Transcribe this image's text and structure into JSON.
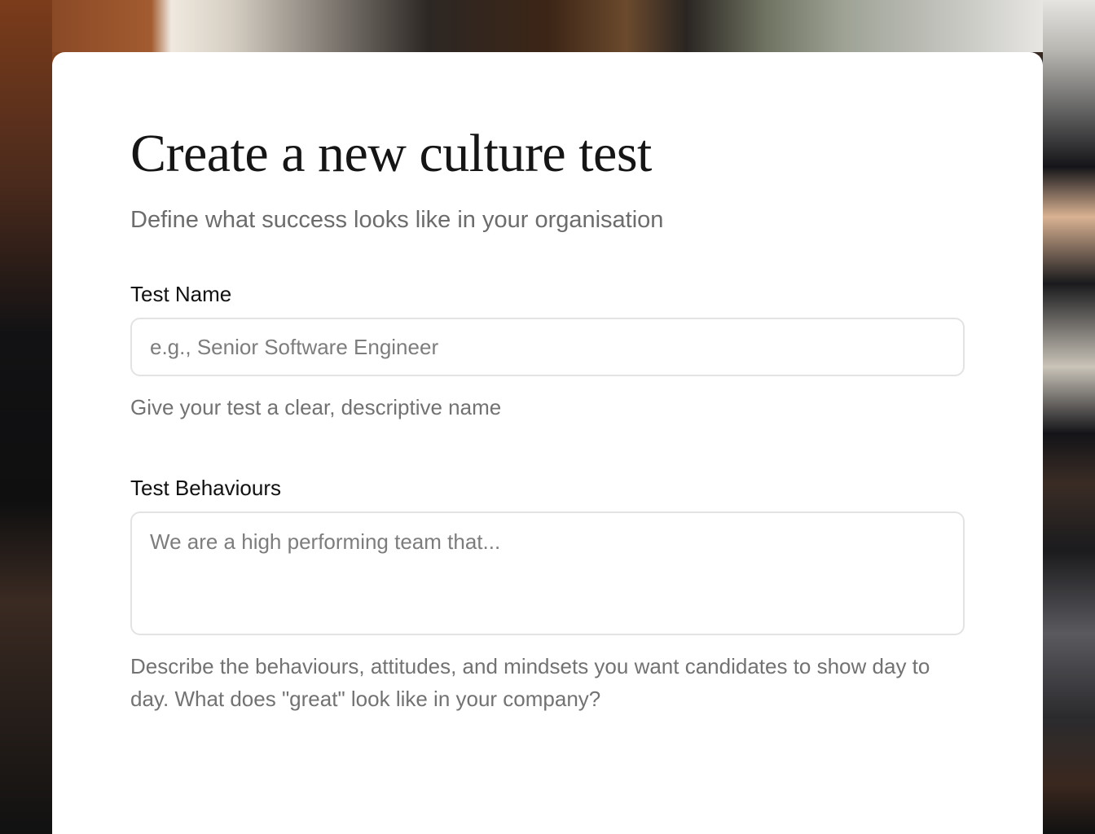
{
  "form": {
    "title": "Create a new culture test",
    "subtitle": "Define what success looks like in your organisation",
    "test_name": {
      "label": "Test Name",
      "placeholder": "e.g., Senior Software Engineer",
      "value": "",
      "helper": "Give your test a clear, descriptive name"
    },
    "test_behaviours": {
      "label": "Test Behaviours",
      "placeholder": "We are a high performing team that...",
      "value": "",
      "helper": "Describe the behaviours, attitudes, and mindsets you want candidates to show day to day. What does \"great\" look like in your company?"
    }
  },
  "colors": {
    "card_background": "#ffffff",
    "title_text": "#151515",
    "muted_text": "#6c6c6c",
    "input_border": "#e3e3e3"
  }
}
